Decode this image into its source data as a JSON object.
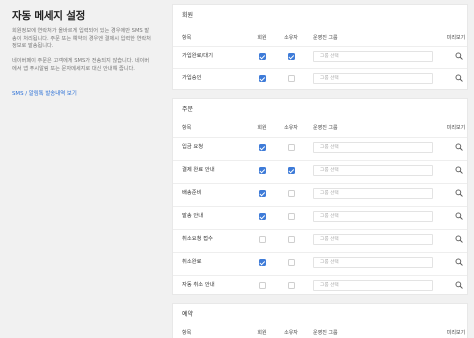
{
  "page": {
    "title": "자동 메세지 설정",
    "description_lines": [
      "회원정보에 연락처가 올바르게 입력되어 있는 경우에만 SMS 발",
      "송이 처리됩니다. 주문 또는 예약의 경우엔 결제시 입력한 연락처",
      "정보로 발송됩니다.",
      "",
      "네이버페이 주문은 고객에게 SMS가 전송되지 않습니다. 네이버",
      "에서 앱 푸시알림 또는 문자메세지로 대신 안내해 줍니다."
    ],
    "link": "SMS / 알림톡 발송내역 보기"
  },
  "columns": {
    "item": "항목",
    "member": "회원",
    "customer": "소유자",
    "group": "운영진 그룹",
    "preview": "미리보기"
  },
  "group_placeholder": "그룹 선택",
  "colors": {
    "accent": "#3e7bd8",
    "link": "#2a6fd6"
  },
  "icons": {
    "preview": "magnifier-icon",
    "checkbox": "check-icon"
  },
  "sections": {
    "member": {
      "title": "회원",
      "rows": [
        {
          "name": "가입완료/대기",
          "member": true,
          "customer": true
        },
        {
          "name": "가입승인",
          "member": true,
          "customer": false
        }
      ]
    },
    "order": {
      "title": "주문",
      "rows": [
        {
          "name": "입금 요청",
          "member": true,
          "customer": false
        },
        {
          "name": "결제 완료 안내",
          "member": true,
          "customer": true
        },
        {
          "name": "배송준비",
          "member": true,
          "customer": false
        },
        {
          "name": "발송 안내",
          "member": true,
          "customer": false
        },
        {
          "name": "취소요청 접수",
          "member": false,
          "customer": false
        },
        {
          "name": "취소완료",
          "member": true,
          "customer": false
        },
        {
          "name": "자동 취소 안내",
          "member": false,
          "customer": false
        }
      ]
    },
    "return": {
      "title": "예약"
    }
  }
}
